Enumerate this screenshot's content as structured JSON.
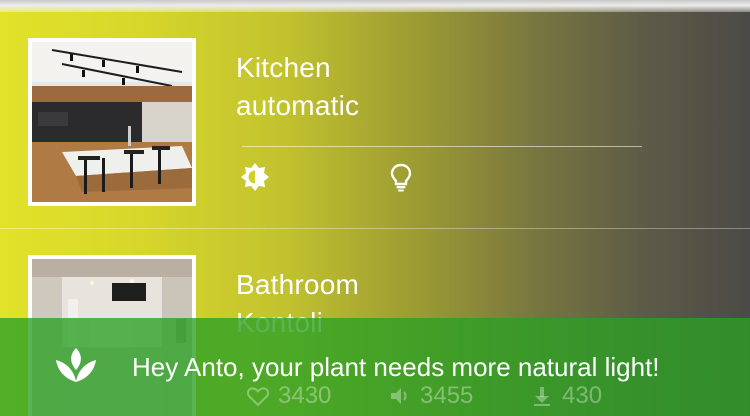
{
  "rooms": [
    {
      "title": "Kitchen",
      "mode": "automatic",
      "controls": [
        "brightness-icon",
        "lightbulb-icon"
      ]
    },
    {
      "title": "Bathroom",
      "mode": "Kontoli"
    }
  ],
  "bathroom_stats": {
    "likes": "3430",
    "plays": "3455",
    "downloads": "430"
  },
  "notification": {
    "icon": "plant-leaves-icon",
    "message": "Hey Anto, your plant needs more natural light!"
  },
  "colors": {
    "gradient_start": "#e2e22a",
    "gradient_end": "#4c4a47",
    "notification_bg": "#2aa024"
  }
}
